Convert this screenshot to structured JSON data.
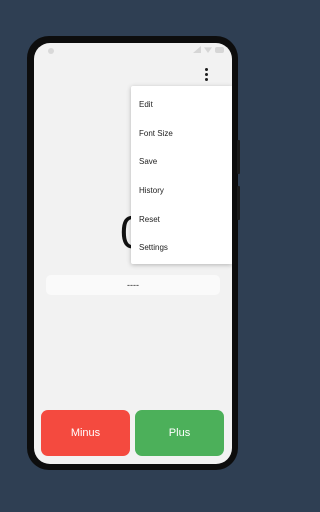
{
  "colors": {
    "background": "#2f3f53",
    "screen": "#f2f2f2",
    "minus": "#f44a3f",
    "plus": "#4cb05a"
  },
  "counter": {
    "value": "0"
  },
  "note": {
    "text": "----"
  },
  "menu": {
    "items": [
      "Edit",
      "Font Size",
      "Save",
      "History",
      "Reset",
      "Settings"
    ]
  },
  "buttons": {
    "minus_label": "Minus",
    "plus_label": "Plus"
  },
  "icons": {
    "overflow": "more-vert-icon",
    "signal": "signal-icon",
    "wifi": "wifi-icon",
    "battery": "battery-icon"
  }
}
